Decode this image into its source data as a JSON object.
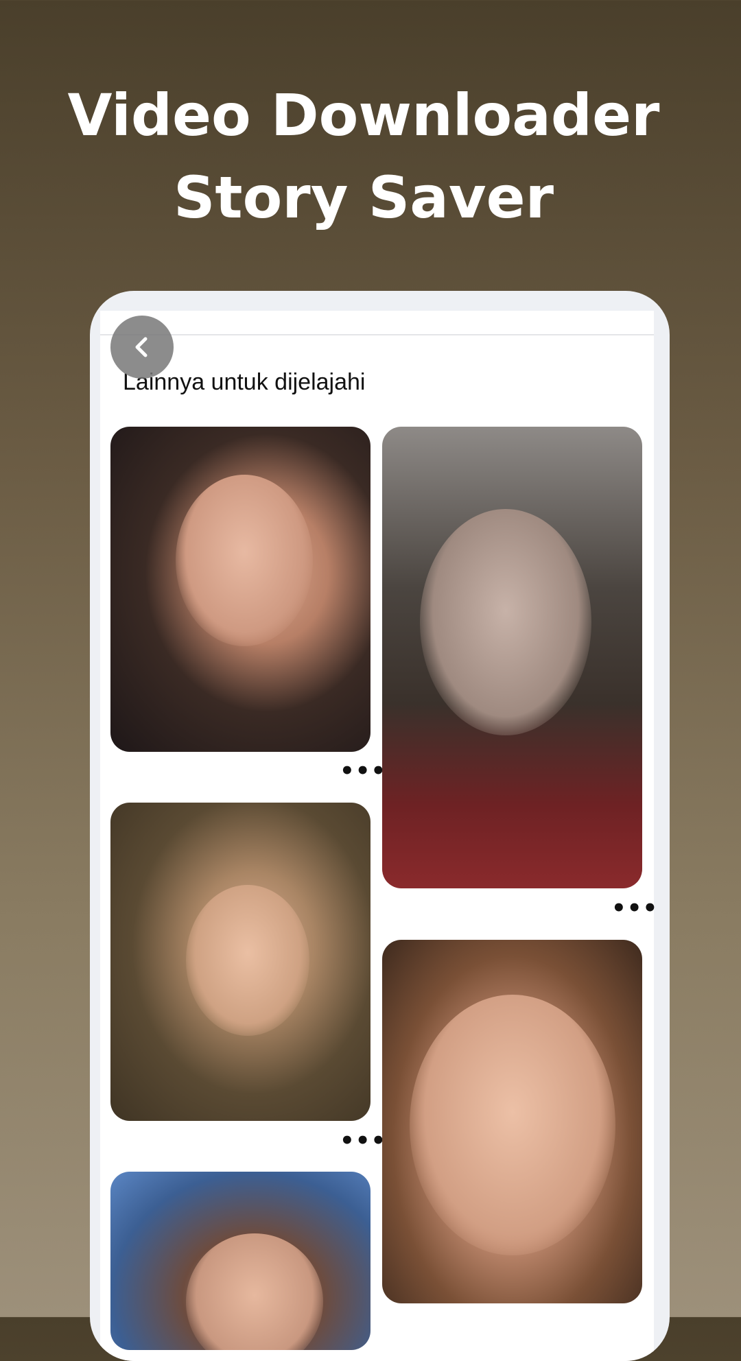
{
  "promo": {
    "title_line1": "Video Downloader",
    "title_line2": "Story Saver"
  },
  "screen": {
    "section_title": "Lainnya untuk dijelajahi",
    "more_icon_label": "•••",
    "back_icon": "chevron-left-icon"
  },
  "colors": {
    "background_top": "#4a3f2b",
    "background_bottom": "#9d907a",
    "phone_frame": "#eef0f4",
    "back_button": "#787878"
  }
}
